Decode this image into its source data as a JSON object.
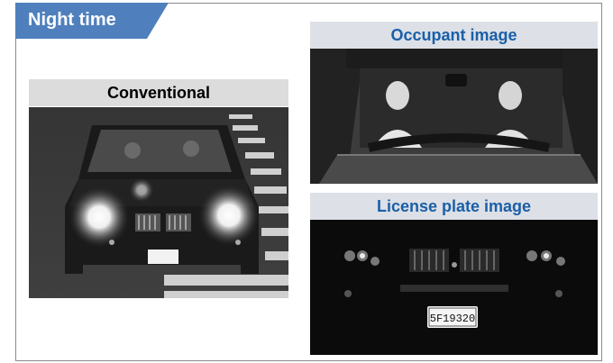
{
  "tab": {
    "label": "Night time",
    "color": "#4f80bd"
  },
  "conventional": {
    "title": "Conventional"
  },
  "occupant": {
    "title": "Occupant image"
  },
  "plate": {
    "title": "License plate image",
    "plate_text": "5F19320"
  },
  "colors": {
    "tab": "#4f80bd",
    "blue_title": "#1a5fa8",
    "label_gray": "#dcdcdc",
    "label_blue": "#dde0e6"
  }
}
